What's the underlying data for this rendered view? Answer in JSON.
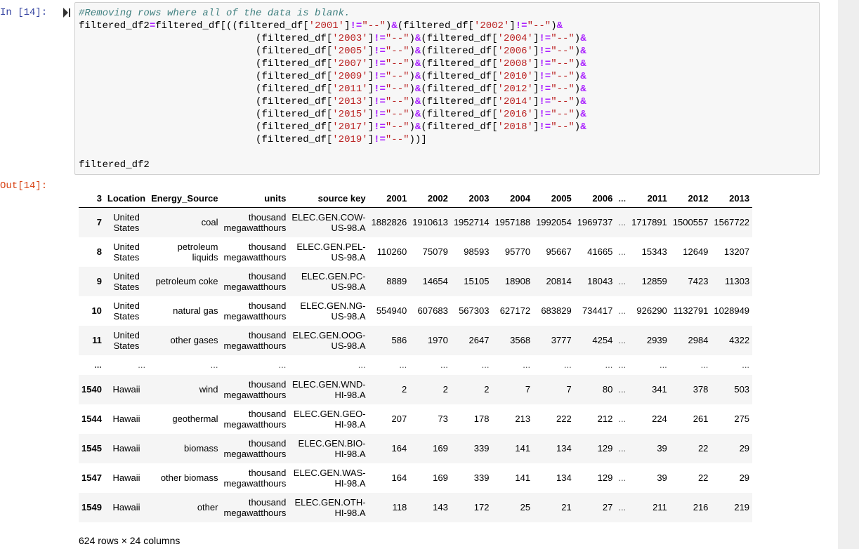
{
  "input_prompt": "In [14]:",
  "output_prompt": "Out[14]:",
  "code": {
    "comment": "#Removing rows where all of the data is blank.",
    "assign_target": "filtered_df2",
    "source_df": "filtered_df",
    "years": [
      "2001",
      "2002",
      "2003",
      "2004",
      "2005",
      "2006",
      "2007",
      "2008",
      "2009",
      "2010",
      "2011",
      "2012",
      "2013",
      "2014",
      "2015",
      "2016",
      "2017",
      "2018",
      "2019"
    ],
    "blank_value": "--",
    "last_line": "filtered_df2"
  },
  "table": {
    "index_header": "3",
    "columns": [
      "Location",
      "Energy_Source",
      "units",
      "source key",
      "2001",
      "2002",
      "2003",
      "2004",
      "2005",
      "2006",
      "...",
      "2011",
      "2012",
      "2013"
    ],
    "rows": [
      {
        "index": "7",
        "location": [
          "United",
          "States"
        ],
        "source": [
          "coal"
        ],
        "units": [
          "thousand",
          "megawatthours"
        ],
        "key": [
          "ELEC.GEN.COW-",
          "US-98.A"
        ],
        "values": [
          "1882826",
          "1910613",
          "1952714",
          "1957188",
          "1992054",
          "1969737",
          "...",
          "1717891",
          "1500557",
          "1567722"
        ]
      },
      {
        "index": "8",
        "location": [
          "United",
          "States"
        ],
        "source": [
          "petroleum",
          "liquids"
        ],
        "units": [
          "thousand",
          "megawatthours"
        ],
        "key": [
          "ELEC.GEN.PEL-",
          "US-98.A"
        ],
        "values": [
          "110260",
          "75079",
          "98593",
          "95770",
          "95667",
          "41665",
          "...",
          "15343",
          "12649",
          "13207"
        ]
      },
      {
        "index": "9",
        "location": [
          "United",
          "States"
        ],
        "source": [
          "petroleum coke"
        ],
        "units": [
          "thousand",
          "megawatthours"
        ],
        "key": [
          "ELEC.GEN.PC-",
          "US-98.A"
        ],
        "values": [
          "8889",
          "14654",
          "15105",
          "18908",
          "20814",
          "18043",
          "...",
          "12859",
          "7423",
          "11303"
        ]
      },
      {
        "index": "10",
        "location": [
          "United",
          "States"
        ],
        "source": [
          "natural gas"
        ],
        "units": [
          "thousand",
          "megawatthours"
        ],
        "key": [
          "ELEC.GEN.NG-",
          "US-98.A"
        ],
        "values": [
          "554940",
          "607683",
          "567303",
          "627172",
          "683829",
          "734417",
          "...",
          "926290",
          "1132791",
          "1028949"
        ]
      },
      {
        "index": "11",
        "location": [
          "United",
          "States"
        ],
        "source": [
          "other gases"
        ],
        "units": [
          "thousand",
          "megawatthours"
        ],
        "key": [
          "ELEC.GEN.OOG-",
          "US-98.A"
        ],
        "values": [
          "586",
          "1970",
          "2647",
          "3568",
          "3777",
          "4254",
          "...",
          "2939",
          "2984",
          "4322"
        ]
      },
      {
        "ellipsis": true,
        "index": "...",
        "cells": [
          "...",
          "...",
          "...",
          "...",
          "...",
          "...",
          "...",
          "...",
          "...",
          "...",
          "...",
          "...",
          "...",
          "..."
        ]
      },
      {
        "index": "1540",
        "location": [
          "Hawaii"
        ],
        "source": [
          "wind"
        ],
        "units": [
          "thousand",
          "megawatthours"
        ],
        "key": [
          "ELEC.GEN.WND-",
          "HI-98.A"
        ],
        "values": [
          "2",
          "2",
          "2",
          "7",
          "7",
          "80",
          "...",
          "341",
          "378",
          "503"
        ]
      },
      {
        "index": "1544",
        "location": [
          "Hawaii"
        ],
        "source": [
          "geothermal"
        ],
        "units": [
          "thousand",
          "megawatthours"
        ],
        "key": [
          "ELEC.GEN.GEO-",
          "HI-98.A"
        ],
        "values": [
          "207",
          "73",
          "178",
          "213",
          "222",
          "212",
          "...",
          "224",
          "261",
          "275"
        ]
      },
      {
        "index": "1545",
        "location": [
          "Hawaii"
        ],
        "source": [
          "biomass"
        ],
        "units": [
          "thousand",
          "megawatthours"
        ],
        "key": [
          "ELEC.GEN.BIO-",
          "HI-98.A"
        ],
        "values": [
          "164",
          "169",
          "339",
          "141",
          "134",
          "129",
          "...",
          "39",
          "22",
          "29"
        ]
      },
      {
        "index": "1547",
        "location": [
          "Hawaii"
        ],
        "source": [
          "other biomass"
        ],
        "units": [
          "thousand",
          "megawatthours"
        ],
        "key": [
          "ELEC.GEN.WAS-",
          "HI-98.A"
        ],
        "values": [
          "164",
          "169",
          "339",
          "141",
          "134",
          "129",
          "...",
          "39",
          "22",
          "29"
        ]
      },
      {
        "index": "1549",
        "location": [
          "Hawaii"
        ],
        "source": [
          "other"
        ],
        "units": [
          "thousand",
          "megawatthours"
        ],
        "key": [
          "ELEC.GEN.OTH-",
          "HI-98.A"
        ],
        "values": [
          "118",
          "143",
          "172",
          "25",
          "21",
          "27",
          "...",
          "211",
          "216",
          "219"
        ]
      }
    ]
  },
  "shape_summary": "624 rows × 24 columns",
  "colors": {
    "prompt_in": "#303f9f",
    "prompt_out": "#d84315",
    "comment": "#408080",
    "operator": "#aa22ff",
    "string": "#ba2121"
  },
  "icons": {
    "run": "run-cell-icon"
  }
}
